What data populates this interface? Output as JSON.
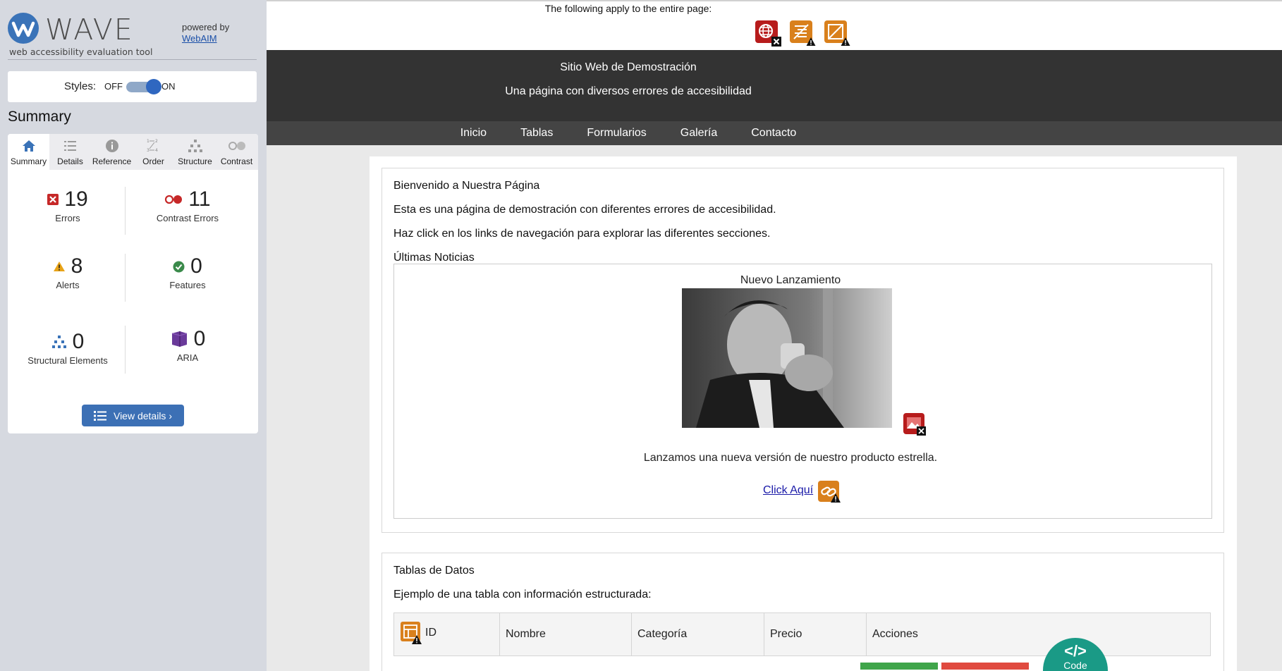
{
  "wave": {
    "brand_name": "WAVE",
    "tagline": "web accessibility evaluation tool",
    "powered_by": "powered by",
    "webaim_link": "WebAIM",
    "styles_label": "Styles:",
    "styles_off": "OFF",
    "styles_on": "ON",
    "summary_title": "Summary",
    "tabs": [
      {
        "label": "Summary",
        "icon": "home-icon",
        "active": true
      },
      {
        "label": "Details",
        "icon": "list-icon",
        "active": false
      },
      {
        "label": "Reference",
        "icon": "info-icon",
        "active": false
      },
      {
        "label": "Order",
        "icon": "order-icon",
        "active": false
      },
      {
        "label": "Structure",
        "icon": "structure-icon",
        "active": false
      },
      {
        "label": "Contrast",
        "icon": "contrast-icon",
        "active": false
      }
    ],
    "stats": {
      "errors": {
        "count": "19",
        "label": "Errors",
        "color": "#c62828"
      },
      "contrast_errors": {
        "count": "11",
        "label": "Contrast Errors",
        "color": "#c62828"
      },
      "alerts": {
        "count": "8",
        "label": "Alerts",
        "color": "#e8a317"
      },
      "features": {
        "count": "0",
        "label": "Features",
        "color": "#3a8a4a"
      },
      "structural": {
        "count": "0",
        "label": "Structural Elements",
        "color": "#3a73b8"
      },
      "aria": {
        "count": "0",
        "label": "ARIA",
        "color": "#6a3a9a"
      }
    },
    "view_details_label": "View details ›"
  },
  "page_notice": {
    "text": "The following apply to the entire page:",
    "icons": [
      "language-missing-error-icon",
      "no-heading-structure-alert-icon",
      "no-page-regions-alert-icon"
    ]
  },
  "site": {
    "title": "Sitio Web de Demostración",
    "subtitle": "Una página con diversos errores de accesibilidad",
    "nav": [
      "Inicio",
      "Tablas",
      "Formularios",
      "Galería",
      "Contacto"
    ],
    "welcome": {
      "heading": "Bienvenido a Nuestra Página",
      "p1": "Esta es una página de demostración con diferentes errores de accesibilidad.",
      "p2": "Haz click en los links de navegación para explorar las diferentes secciones.",
      "news_heading": "Últimas Noticias",
      "news": {
        "title": "Nuevo Lanzamiento",
        "description": "Lanzamos una nueva versión de nuestro producto estrella.",
        "link": "Click Aquí"
      }
    },
    "tables": {
      "heading": "Tablas de Datos",
      "intro": "Ejemplo de una tabla con información estructurada:",
      "columns": [
        "ID",
        "Nombre",
        "Categoría",
        "Precio",
        "Acciones"
      ]
    }
  },
  "code_tab": {
    "label": "Code",
    "symbol": "</>"
  },
  "colors": {
    "wave_blue": "#3a73b8",
    "site_header": "#333333",
    "site_nav": "#444444",
    "error_red": "#c62828",
    "alert_orange": "#d9801c",
    "code_teal": "#1a9a86"
  }
}
